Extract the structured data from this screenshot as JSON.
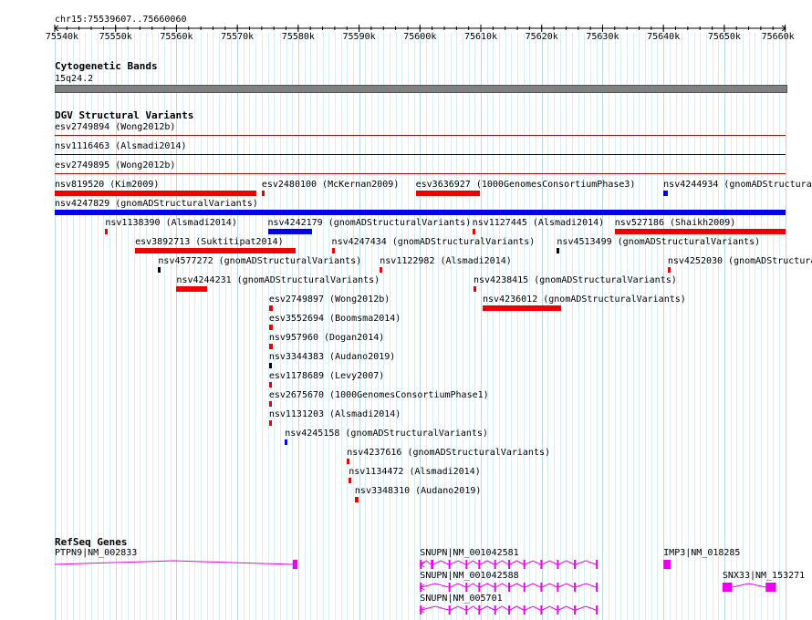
{
  "region": "chr15:75539607..75660060",
  "ruler": {
    "ticks": [
      {
        "label": "75540k",
        "bp": 75540000
      },
      {
        "label": "75550k",
        "bp": 75550000
      },
      {
        "label": "75560k",
        "bp": 75560000
      },
      {
        "label": "75570k",
        "bp": 75570000
      },
      {
        "label": "75580k",
        "bp": 75580000
      },
      {
        "label": "75590k",
        "bp": 75590000
      },
      {
        "label": "75600k",
        "bp": 75600000
      },
      {
        "label": "75610k",
        "bp": 75610000
      },
      {
        "label": "75620k",
        "bp": 75620000
      },
      {
        "label": "75630k",
        "bp": 75630000
      },
      {
        "label": "75640k",
        "bp": 75640000
      },
      {
        "label": "75650k",
        "bp": 75650000
      },
      {
        "label": "75660k",
        "bp": 75660000
      }
    ]
  },
  "cytoband": {
    "title": "Cytogenetic Bands",
    "band": "15q24.2",
    "color": "#808080"
  },
  "dgv": {
    "title": "DGV Structural Variants",
    "spanning": [
      {
        "id": "esv2749894",
        "label": "esv2749894 (Wong2012b)",
        "color": "#cc0000"
      },
      {
        "id": "nsv1116463",
        "label": "nsv1116463 (Alsmadi2014)",
        "color": "#000080"
      },
      {
        "id": "esv2749895",
        "label": "esv2749895 (Wong2012b)",
        "color": "#cc0000"
      }
    ],
    "features": [
      {
        "label": "nsv819520 (Kim2009)",
        "start": 75540000,
        "end": 75573200,
        "color": "#ee0000",
        "arrow": true
      },
      {
        "label": "esv2480100 (McKernan2009)",
        "start": 75574000,
        "end": 75574400,
        "color": "#ee0000"
      },
      {
        "label": "esv3636927 (1000GenomesConsortiumPhase3)",
        "start": 75599300,
        "end": 75609800,
        "color": "#ee0000",
        "arrow": true
      },
      {
        "label": "nsv4244934 (gnomADStructuralVariants)",
        "start": 75640000,
        "end": 75640800,
        "color": "#0000ee"
      },
      {
        "label": "nsv4247829 (gnomADStructuralVariants)",
        "start": 75540000,
        "end": 75660060,
        "color": "#0000ee"
      },
      {
        "label": "nsv1138390 (Alsmadi2014)",
        "start": 75548300,
        "end": 75548500,
        "color": "#ee0000"
      },
      {
        "label": "nsv4242179 (gnomADStructuralVariants)",
        "start": 75575000,
        "end": 75582200,
        "color": "#0000ee"
      },
      {
        "label": "nsv1127445 (Alsmadi2014)",
        "start": 75608600,
        "end": 75608900,
        "color": "#ee0000"
      },
      {
        "label": "nsv527186 (Shaikh2009)",
        "start": 75632000,
        "end": 75660060,
        "color": "#ee0000"
      },
      {
        "label": "esv3892713 (Suktitipat2014)",
        "start": 75553200,
        "end": 75579500,
        "color": "#ee0000"
      },
      {
        "label": "nsv4247434 (gnomADStructuralVariants)",
        "start": 75585500,
        "end": 75585900,
        "color": "#ee0000"
      },
      {
        "label": "nsv4513499 (gnomADStructuralVariants)",
        "start": 75622500,
        "end": 75622800,
        "color": "#000000"
      },
      {
        "label": "nsv4577272 (gnomADStructuralVariants)",
        "start": 75557000,
        "end": 75557300,
        "color": "#000000"
      },
      {
        "label": "nsv1122982 (Alsmadi2014)",
        "start": 75593400,
        "end": 75593700,
        "color": "#ee0000"
      },
      {
        "label": "nsv4252030 (gnomADStructuralVariants)",
        "start": 75640700,
        "end": 75641000,
        "color": "#ee0000"
      },
      {
        "label": "nsv4244231 (gnomADStructuralVariants)",
        "start": 75560000,
        "end": 75565000,
        "color": "#ee0000"
      },
      {
        "label": "nsv4238415 (gnomADStructuralVariants)",
        "start": 75608800,
        "end": 75609100,
        "color": "#ee0000"
      },
      {
        "label": "esv2749897 (Wong2012b)",
        "start": 75575200,
        "end": 75575900,
        "color": "#ee0000"
      },
      {
        "label": "nsv4236012 (gnomADStructuralVariants)",
        "start": 75610300,
        "end": 75623200,
        "color": "#ee0000"
      },
      {
        "label": "esv3552694 (Boomsma2014)",
        "start": 75575200,
        "end": 75575900,
        "color": "#ee0000"
      },
      {
        "label": "nsv957960 (Dogan2014)",
        "start": 75575200,
        "end": 75575900,
        "color": "#ee0000"
      },
      {
        "label": "nsv3344383 (Audano2019)",
        "start": 75575200,
        "end": 75575500,
        "color": "#000000"
      },
      {
        "label": "esv1178689 (Levy2007)",
        "start": 75575200,
        "end": 75575500,
        "color": "#ee0000"
      },
      {
        "label": "esv2675670 (1000GenomesConsortiumPhase1)",
        "start": 75575200,
        "end": 75575500,
        "color": "#ee0000"
      },
      {
        "label": "nsv1131203 (Alsmadi2014)",
        "start": 75575200,
        "end": 75575500,
        "color": "#ee0000"
      },
      {
        "label": "nsv4245158 (gnomADStructuralVariants)",
        "start": 75577800,
        "end": 75578100,
        "color": "#0000ee"
      },
      {
        "label": "nsv4237616 (gnomADStructuralVariants)",
        "start": 75588000,
        "end": 75588300,
        "color": "#ee0000"
      },
      {
        "label": "nsv1134472 (Alsmadi2014)",
        "start": 75588300,
        "end": 75588600,
        "color": "#ee0000"
      },
      {
        "label": "nsv3348310 (Audano2019)",
        "start": 75589300,
        "end": 75589900,
        "color": "#ee0000"
      }
    ]
  },
  "refseq": {
    "title": "RefSeq Genes",
    "color": "#ee00ee",
    "genes": [
      {
        "label": "PTPN9|NM_002833",
        "start": 75540000,
        "end": 75579900,
        "exons": [
          [
            75579100,
            75579900
          ]
        ]
      },
      {
        "label": "SNUPN|NM_001042581",
        "start": 75600000,
        "end": 75629200,
        "exons": [
          [
            75600000,
            75600300
          ],
          [
            75601800,
            75602200
          ],
          [
            75604700,
            75605000
          ],
          [
            75607500,
            75607800
          ],
          [
            75609600,
            75609900
          ],
          [
            75612200,
            75612500
          ],
          [
            75614500,
            75614800
          ],
          [
            75617000,
            75617300
          ],
          [
            75619800,
            75620100
          ],
          [
            75622500,
            75622800
          ],
          [
            75625300,
            75625600
          ],
          [
            75628900,
            75629200
          ]
        ],
        "arrow": true
      },
      {
        "label": "SNUPN|NM_001042588",
        "start": 75600000,
        "end": 75629200,
        "exons": [
          [
            75600000,
            75600300
          ],
          [
            75604700,
            75605000
          ],
          [
            75607500,
            75607800
          ],
          [
            75609600,
            75609900
          ],
          [
            75612200,
            75612500
          ],
          [
            75614500,
            75614800
          ],
          [
            75617000,
            75617300
          ],
          [
            75619800,
            75620100
          ],
          [
            75622500,
            75622800
          ],
          [
            75625300,
            75625600
          ],
          [
            75628900,
            75629200
          ]
        ],
        "arrow": true
      },
      {
        "label": "SNUPN|NM_005701",
        "start": 75600000,
        "end": 75629200,
        "exons": [
          [
            75600000,
            75600300
          ],
          [
            75604700,
            75605000
          ],
          [
            75607500,
            75607800
          ],
          [
            75609600,
            75609900
          ],
          [
            75612200,
            75612500
          ],
          [
            75614500,
            75614800
          ],
          [
            75617000,
            75617300
          ],
          [
            75619800,
            75620100
          ],
          [
            75622500,
            75622800
          ],
          [
            75625300,
            75625600
          ],
          [
            75628900,
            75629200
          ]
        ],
        "arrow": true
      },
      {
        "label": "IMP3|NM_018285",
        "start": 75640000,
        "end": 75641200,
        "exons": [
          [
            75640000,
            75641200
          ]
        ]
      },
      {
        "label": "SNX33|NM_153271",
        "start": 75649700,
        "end": 75658500,
        "exons": [
          [
            75649700,
            75651300
          ],
          [
            75656800,
            75658500
          ]
        ]
      }
    ]
  }
}
